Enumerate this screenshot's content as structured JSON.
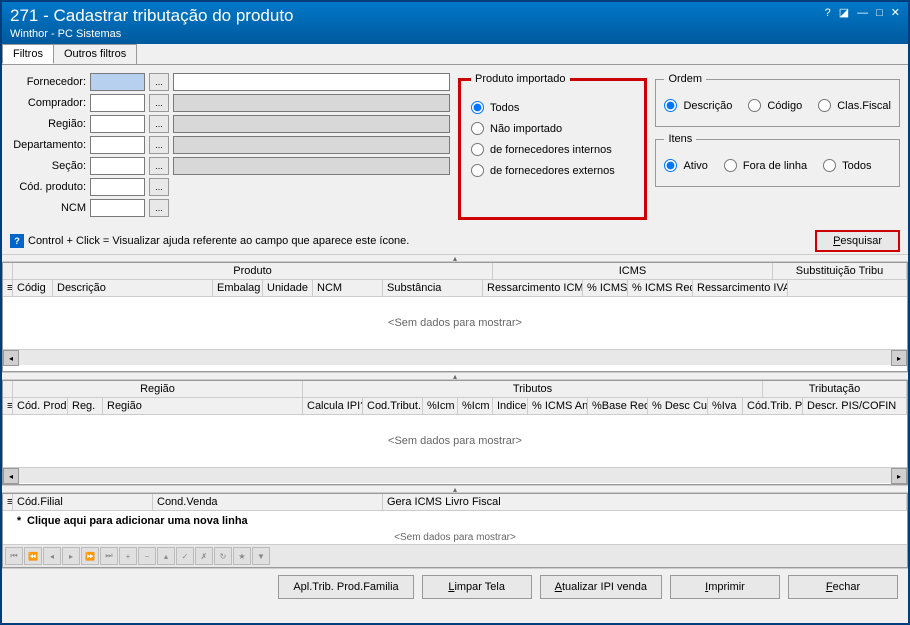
{
  "title": {
    "main": "271 - Cadastrar tributação do produto",
    "sub": "Winthor - PC Sistemas"
  },
  "tabs": {
    "filtros": "Filtros",
    "outros": "Outros filtros"
  },
  "filters": {
    "fornecedor": "Fornecedor:",
    "comprador": "Comprador:",
    "regiao": "Região:",
    "departamento": "Departamento:",
    "secao": "Seção:",
    "codproduto": "Cód. produto:",
    "ncm": "NCM"
  },
  "produtoImportado": {
    "legend": "Produto importado",
    "todos": "Todos",
    "naoImportado": "Não importado",
    "fornInternos": "de fornecedores internos",
    "fornExternos": "de fornecedores externos"
  },
  "ordem": {
    "legend": "Ordem",
    "descricao": "Descrição",
    "codigo": "Código",
    "clasFiscal": "Clas.Fiscal"
  },
  "itens": {
    "legend": "Itens",
    "ativo": "Ativo",
    "foraLinha": "Fora de linha",
    "todos": "Todos"
  },
  "helpText": "Control + Click = Visualizar ajuda referente ao campo que aparece este ícone.",
  "pesquisar": "Pesquisar",
  "grid1": {
    "groups": {
      "produto": "Produto",
      "icms": "ICMS",
      "subst": "Substituição Tribu"
    },
    "cols": {
      "codigo": "Códig",
      "descricao": "Descrição",
      "embalagem": "Embalag",
      "unidade": "Unidade",
      "ncm": "NCM",
      "substancia": "Substância",
      "ressIcms": "Ressarcimento ICMS",
      "pctIcms": "% ICMS",
      "pctIcmsRed": "% ICMS Red.",
      "ressIva": "Ressarcimento IVA"
    },
    "noData": "<Sem dados para mostrar>"
  },
  "grid2": {
    "groups": {
      "regiao": "Região",
      "tributos": "Tributos",
      "tributacao": "Tributação"
    },
    "cols": {
      "codProd": "Cód. Prod",
      "reg": "Reg.",
      "regiao": "Região",
      "calcIpi": "Calcula IPI?",
      "codTribut": "Cod.Tribut.",
      "pctIcm1": "%Icm",
      "pctIcm2": "%Icm",
      "indice": "Indice",
      "pctIcmsAnt": "% ICMS Ant",
      "pctBaseRed": "%Base Red.",
      "pctDescCus": "% Desc Cus",
      "pctIva": "%Iva",
      "codTribPi": "Cód.Trib. PI",
      "descrPis": "Descr. PIS/COFIN"
    },
    "noData": "<Sem dados para mostrar>"
  },
  "grid3": {
    "cols": {
      "codFilial": "Cód.Filial",
      "condVenda": "Cond.Venda",
      "geraIcms": "Gera ICMS Livro Fiscal"
    },
    "addRow": "Clique aqui para adicionar uma nova linha",
    "noData": "<Sem dados para mostrar>"
  },
  "buttons": {
    "aplTrib": "Apl.Trib. Prod.Familia",
    "limpar": "Limpar Tela",
    "atualizar": "Atualizar IPI venda",
    "imprimir": "Imprimir",
    "fechar": "Fechar"
  }
}
